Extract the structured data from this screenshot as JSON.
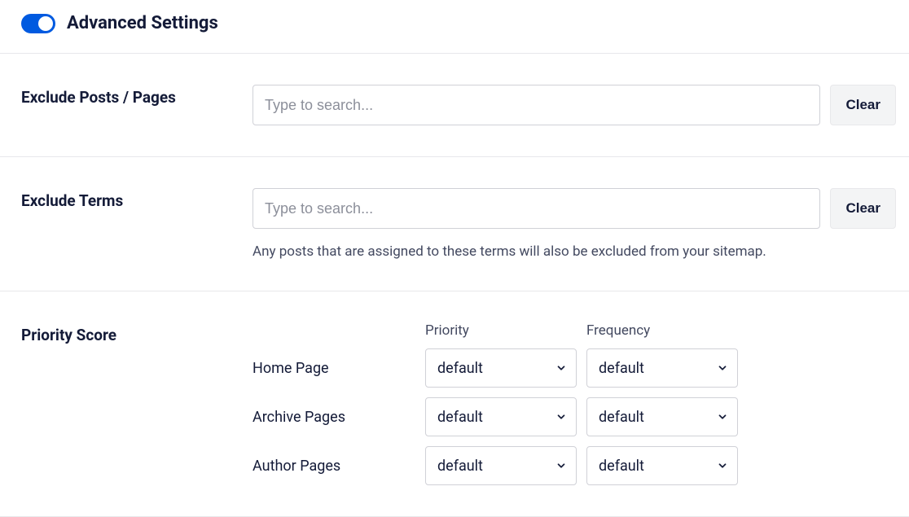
{
  "header": {
    "title": "Advanced Settings",
    "toggle_on": true
  },
  "excludePosts": {
    "label": "Exclude Posts / Pages",
    "placeholder": "Type to search...",
    "value": "",
    "clear_label": "Clear"
  },
  "excludeTerms": {
    "label": "Exclude Terms",
    "placeholder": "Type to search...",
    "value": "",
    "clear_label": "Clear",
    "help": "Any posts that are assigned to these terms will also be excluded from your sitemap."
  },
  "priorityScore": {
    "label": "Priority Score",
    "col_priority": "Priority",
    "col_frequency": "Frequency",
    "rows": [
      {
        "label": "Home Page",
        "priority": "default",
        "frequency": "default"
      },
      {
        "label": "Archive Pages",
        "priority": "default",
        "frequency": "default"
      },
      {
        "label": "Author Pages",
        "priority": "default",
        "frequency": "default"
      }
    ]
  }
}
